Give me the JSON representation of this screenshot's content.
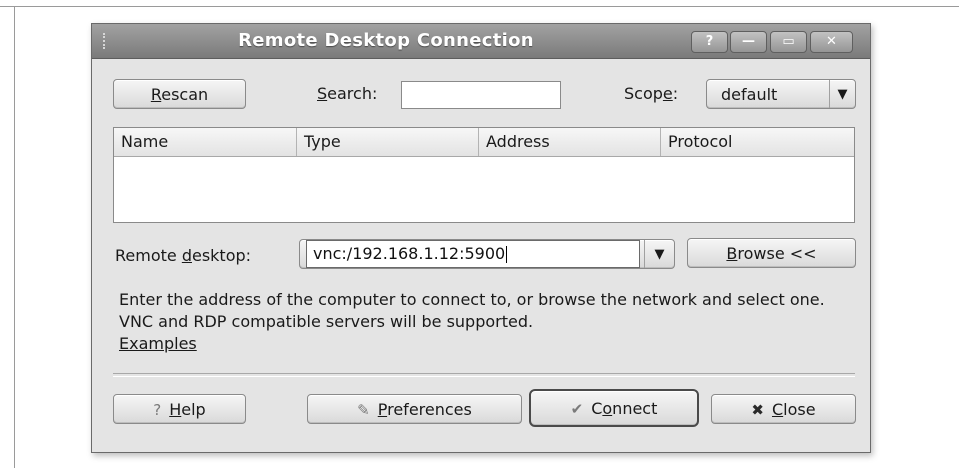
{
  "window": {
    "title": "Remote Desktop Connection",
    "controls": {
      "help": "?",
      "minimize": "—",
      "maximize": "▭",
      "close": "✕"
    }
  },
  "toolbar": {
    "rescan": {
      "pre": "",
      "mnemonic": "R",
      "post": "escan"
    },
    "search_label": {
      "pre": "",
      "mnemonic": "S",
      "post": "earch:"
    },
    "search_value": "",
    "scope_label": {
      "pre": "Scop",
      "mnemonic": "e",
      "post": ":"
    },
    "scope_value": "default",
    "scope_arrow": "▼"
  },
  "table": {
    "columns": [
      "Name",
      "Type",
      "Address",
      "Protocol"
    ],
    "rows": []
  },
  "remote": {
    "label": {
      "pre": "Remote ",
      "mnemonic": "d",
      "post": "esktop:"
    },
    "value": "vnc:/192.168.1.12:5900",
    "arrow": "▼",
    "browse": {
      "pre": "",
      "mnemonic": "B",
      "post": "rowse <<"
    }
  },
  "description": {
    "text": "Enter the address of the computer to connect to, or browse the network and select one. VNC and RDP compatible servers will be supported.",
    "link": "Examples"
  },
  "footer": {
    "help": {
      "pre": "",
      "mnemonic": "H",
      "post": "elp",
      "icon": "?"
    },
    "preferences": {
      "pre": "",
      "mnemonic": "P",
      "post": "references",
      "icon": "✎"
    },
    "connect": {
      "pre": "C",
      "mnemonic": "o",
      "post": "nnect",
      "icon": "✔"
    },
    "close": {
      "pre": "",
      "mnemonic": "C",
      "post": "lose",
      "icon": "✖"
    }
  }
}
